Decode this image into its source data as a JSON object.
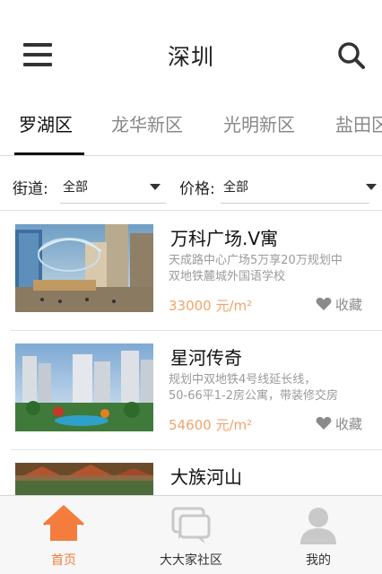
{
  "header": {
    "title": "深圳",
    "menu_icon": "hamburger-menu-icon",
    "search_icon": "search-icon"
  },
  "tabs": [
    {
      "label": "罗湖区",
      "active": true
    },
    {
      "label": "龙华新区",
      "active": false
    },
    {
      "label": "光明新区",
      "active": false
    },
    {
      "label": "盐田区",
      "active": false
    }
  ],
  "filters": {
    "street": {
      "label": "街道:",
      "value": "全部"
    },
    "price": {
      "label": "价格:",
      "value": "全部"
    }
  },
  "listings": [
    {
      "title": "万科广场.V寓",
      "desc_line1": "天成路中心广场5万享20万规划中",
      "desc_line2": "双地铁麓城外国语学校",
      "price": "33000 元/m²",
      "favorite_label": "收藏"
    },
    {
      "title": "星河传奇",
      "desc_line1": "规划中双地铁4号线延长线，",
      "desc_line2": "50-66平1-2房公寓，带装修交房",
      "price": "54600 元/m²",
      "favorite_label": "收藏"
    },
    {
      "title": "大族河山",
      "desc_line1": "",
      "desc_line2": "",
      "price": "",
      "favorite_label": ""
    }
  ],
  "bottom_nav": [
    {
      "label": "首页",
      "icon": "home-icon",
      "active": true
    },
    {
      "label": "大大家社区",
      "icon": "chat-bubbles-icon",
      "active": false
    },
    {
      "label": "我的",
      "icon": "user-icon",
      "active": false
    }
  ],
  "colors": {
    "accent": "#f47c3c",
    "price": "#f2a36b",
    "muted_text": "#9b9b9b"
  }
}
